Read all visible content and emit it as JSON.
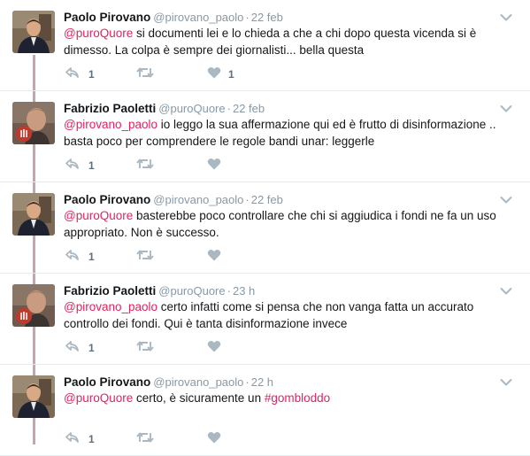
{
  "tweets": [
    {
      "name": "Paolo Pirovano",
      "handle": "@pirovano_paolo",
      "time": "22 feb",
      "avatar": "paolo",
      "segments": [
        {
          "type": "mention",
          "text": "@puroQuore"
        },
        {
          "type": "text",
          "text": " si documenti lei e lo chieda a che a chi dopo questa vicenda si è dimesso. La colpa è sempre dei giornalisti... bella questa"
        }
      ],
      "reply_count": "1",
      "retweet_count": "",
      "like_count": "1"
    },
    {
      "name": "Fabrizio Paoletti",
      "handle": "@puroQuore",
      "time": "22 feb",
      "avatar": "fabrizio",
      "segments": [
        {
          "type": "mention",
          "text": "@pirovano_paolo"
        },
        {
          "type": "text",
          "text": " io leggo la sua affermazione qui ed è frutto di disinformazione .. basta poco per comprendere le regole bandi unar: leggerle"
        }
      ],
      "reply_count": "1",
      "retweet_count": "",
      "like_count": ""
    },
    {
      "name": "Paolo Pirovano",
      "handle": "@pirovano_paolo",
      "time": "22 feb",
      "avatar": "paolo",
      "segments": [
        {
          "type": "mention",
          "text": "@puroQuore"
        },
        {
          "type": "text",
          "text": " basterebbe poco controllare che chi si aggiudica i fondi ne fa un uso appropriato. Non è successo."
        }
      ],
      "reply_count": "1",
      "retweet_count": "",
      "like_count": ""
    },
    {
      "name": "Fabrizio Paoletti",
      "handle": "@puroQuore",
      "time": "23 h",
      "avatar": "fabrizio",
      "segments": [
        {
          "type": "mention",
          "text": "@pirovano_paolo"
        },
        {
          "type": "text",
          "text": " certo infatti come si pensa che non vanga fatta un accurato controllo dei fondi. Qui è tanta disinformazione invece"
        }
      ],
      "reply_count": "1",
      "retweet_count": "",
      "like_count": ""
    },
    {
      "name": "Paolo Pirovano",
      "handle": "@pirovano_paolo",
      "time": "22 h",
      "avatar": "paolo",
      "segments": [
        {
          "type": "mention",
          "text": "@puroQuore"
        },
        {
          "type": "text",
          "text": " certo, è sicuramente un "
        },
        {
          "type": "hashtag",
          "text": "#gombloddo"
        }
      ],
      "reply_count": "1",
      "retweet_count": "",
      "like_count": ""
    }
  ],
  "colors": {
    "mention": "#e0245e",
    "thread_line": "#c9a3ab",
    "icon": "#aab8c2"
  },
  "icons": {
    "reply": "reply-icon",
    "retweet": "retweet-icon",
    "like": "heart-icon",
    "more": "chevron-down-icon"
  }
}
